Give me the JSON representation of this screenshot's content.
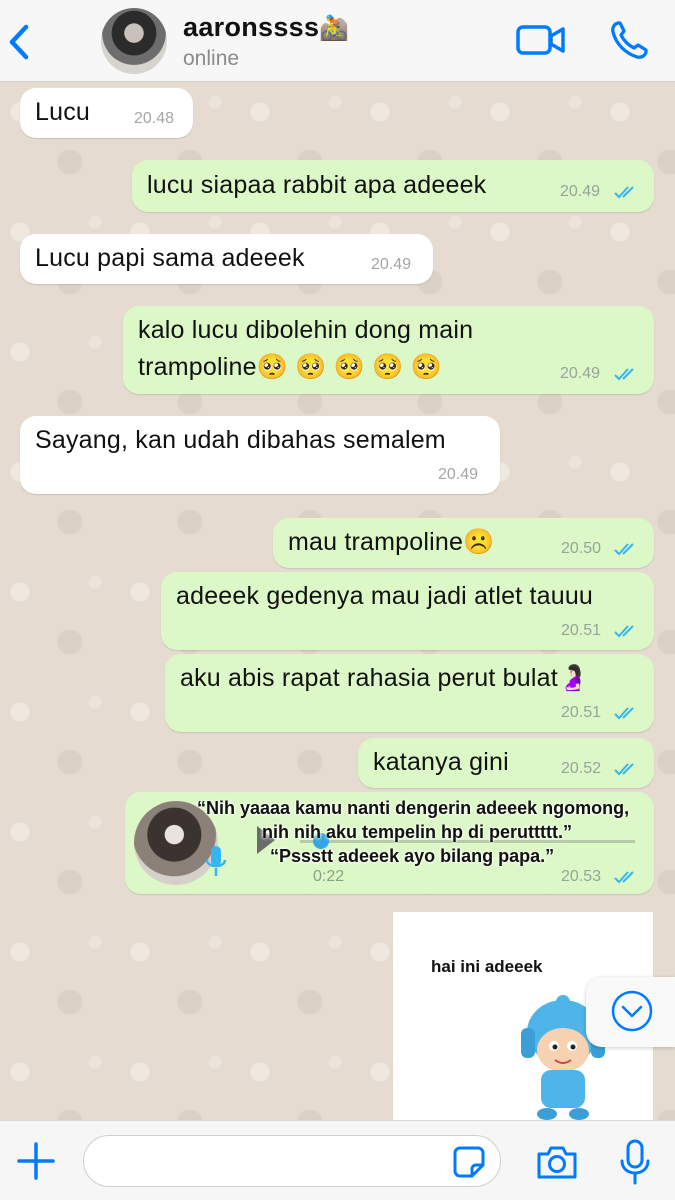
{
  "header": {
    "contact_name": "aaronssss",
    "contact_emoji": "🚵",
    "status": "online"
  },
  "messages": [
    {
      "direction": "in",
      "text": "Lucu",
      "time": "20.48"
    },
    {
      "direction": "out",
      "text": "lucu siapaa rabbit apa adeeek",
      "time": "20.49"
    },
    {
      "direction": "in",
      "text": "Lucu papi sama adeeek",
      "time": "20.49"
    },
    {
      "direction": "out",
      "text_line1": "kalo lucu dibolehin dong main",
      "text_line2": "trampoline🥺 🥺 🥺 🥺 🥺",
      "time": "20.49"
    },
    {
      "direction": "in",
      "text": "Sayang, kan udah dibahas semalem",
      "time": "20.49"
    },
    {
      "direction": "out",
      "text": "mau trampoline☹️",
      "time": "20.50"
    },
    {
      "direction": "out",
      "text": "adeeek gedenya mau jadi atlet tauuu",
      "time": "20.51"
    },
    {
      "direction": "out",
      "text": "aku abis rapat rahasia perut bulat🤰🏻",
      "time": "20.51"
    },
    {
      "direction": "out",
      "text": "katanya gini",
      "time": "20.52"
    },
    {
      "direction": "out",
      "type": "voice",
      "duration": "0:22",
      "time": "20.53",
      "caption_line1": "“Nih yaaaa kamu nanti dengerin adeeek ngomong,",
      "caption_line2": "nih nih aku tempelin hp di peruttttt.”",
      "caption_line3": "“Pssstt adeeek ayo bilang papa.”"
    }
  ],
  "sticker": {
    "caption": "hai ini adeeek"
  },
  "input": {
    "placeholder": ""
  },
  "colors": {
    "accent": "#007aff",
    "outgoing_bubble": "#dcf8c6",
    "incoming_bubble": "#ffffff",
    "read_ticks": "#34b7f1"
  },
  "icons": [
    "back-chevron-icon",
    "video-call-icon",
    "phone-icon",
    "read-ticks-icon",
    "play-icon",
    "mic-icon",
    "chevron-down-icon",
    "plus-icon",
    "sticker-icon",
    "camera-icon"
  ]
}
